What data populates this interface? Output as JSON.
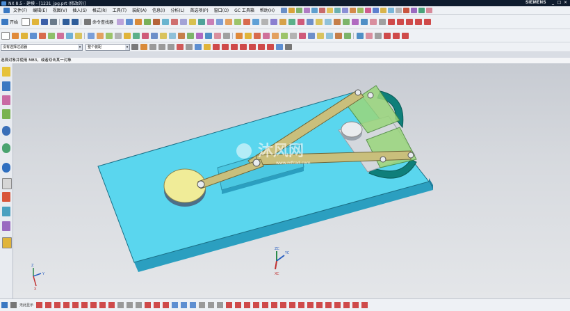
{
  "window": {
    "title": "NX 8.5 - 建模 - [1231_jpg.prt (修改的)]",
    "brand": "SIEMENS",
    "controls": [
      "_",
      "□",
      "×"
    ]
  },
  "menu": {
    "items": [
      "文件(F)",
      "编辑(E)",
      "视图(V)",
      "插入(S)",
      "格式(R)",
      "工具(T)",
      "装配(A)",
      "信息(I)",
      "分析(L)",
      "首选项(P)",
      "窗口(O)",
      "GC 工具箱",
      "帮助(H)"
    ]
  },
  "toolbar1": {
    "start_label": "开始",
    "command_finder_label": "命令查找器"
  },
  "selection_bar": {
    "filter_value": "没有选择过滤器",
    "scope_value": "整个装配"
  },
  "cue_line": {
    "text": "选择对象并使用 MB3，或者双击某一对象"
  },
  "graphics": {
    "watermark_text": "沐风网",
    "watermark_url": "www.mfcad.com",
    "triad_labels": {
      "z": "ZC",
      "y": "YC",
      "x": "XC"
    },
    "small_triad_labels": {
      "z": "Z",
      "y": "Y",
      "x": "X"
    },
    "colors": {
      "base_plate": "#5ad6ee",
      "disk": "#f0ec98",
      "link": "#c9bf7c",
      "green_part": "#9ad67c",
      "dark_teal": "#0f7f7a"
    }
  },
  "bottom": {
    "status_label": "无此显示"
  }
}
